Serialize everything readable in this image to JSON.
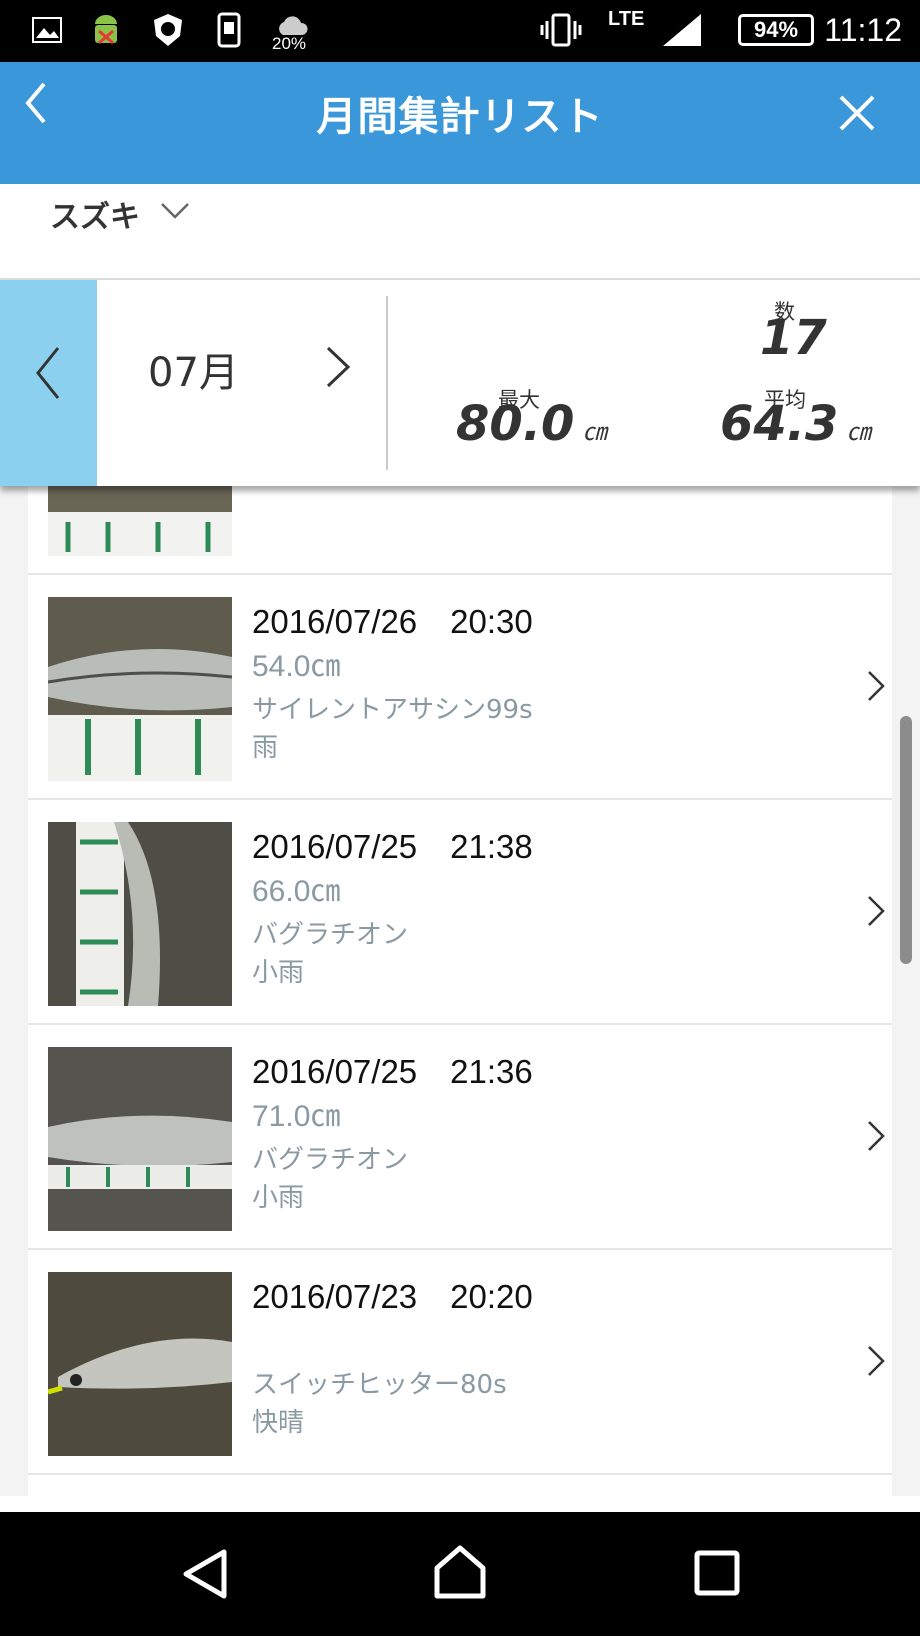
{
  "status_bar": {
    "weather_percent": "20%",
    "network": "LTE",
    "battery": "94%",
    "time": "11:12"
  },
  "header": {
    "title": "月間集計リスト"
  },
  "species": {
    "selected": "スズキ"
  },
  "summary": {
    "month": "07月",
    "count_label": "数",
    "count": "17",
    "max_label": "最大",
    "max_value": "80.0",
    "avg_label": "平均",
    "avg_value": "64.3",
    "unit": "㎝"
  },
  "catches": [
    {
      "date": "2016/07/26　20:30",
      "size": "54.0㎝",
      "lure": "サイレントアサシン99s",
      "weather": "雨"
    },
    {
      "date": "2016/07/25　21:38",
      "size": "66.0㎝",
      "lure": "バグラチオン",
      "weather": "小雨"
    },
    {
      "date": "2016/07/25　21:36",
      "size": "71.0㎝",
      "lure": "バグラチオン",
      "weather": "小雨"
    },
    {
      "date": "2016/07/23　20:20",
      "size": "",
      "lure": "スイッチヒッター80s",
      "weather": "快晴"
    }
  ],
  "colors": {
    "appbar": "#3a97d9",
    "month_prev_bg": "#8bd0ef",
    "secondary_text": "#8a9aa2"
  }
}
